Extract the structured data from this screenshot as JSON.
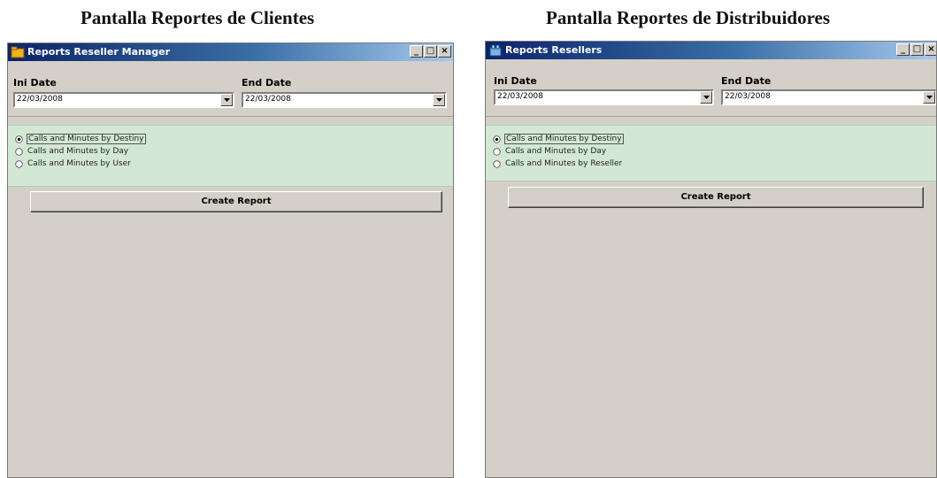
{
  "captions": {
    "left": "Pantalla Reportes de Clientes",
    "right": "Pantalla Reportes de Distribuidores"
  },
  "clients_window": {
    "title": "Reports Reseller Manager",
    "ini_date_label": "Ini Date",
    "ini_date_value": "22/03/2008",
    "end_date_label": "End Date",
    "end_date_value": "22/03/2008",
    "radios": [
      {
        "label": "Calls and Minutes by Destiny",
        "checked": true
      },
      {
        "label": "Calls and Minutes by Day",
        "checked": false
      },
      {
        "label": "Calls and Minutes by User",
        "checked": false
      }
    ],
    "create_button": "Create Report"
  },
  "resellers_window": {
    "title": "Reports Resellers",
    "ini_date_label": "Ini Date",
    "ini_date_value": "22/03/2008",
    "end_date_label": "End Date",
    "end_date_value": "22/03/2008",
    "radios": [
      {
        "label": "Calls and Minutes by Destiny",
        "checked": true
      },
      {
        "label": "Calls and Minutes by Day",
        "checked": false
      },
      {
        "label": "Calls and Minutes by Reseller",
        "checked": false
      }
    ],
    "create_button": "Create Report"
  },
  "title_buttons": {
    "minimize": "_",
    "maximize": "□",
    "close": "×"
  },
  "colors": {
    "titlebar_start": "#0a246a",
    "window_bg": "#d4d0c8",
    "radio_panel_bg": "#d3e8d4"
  }
}
